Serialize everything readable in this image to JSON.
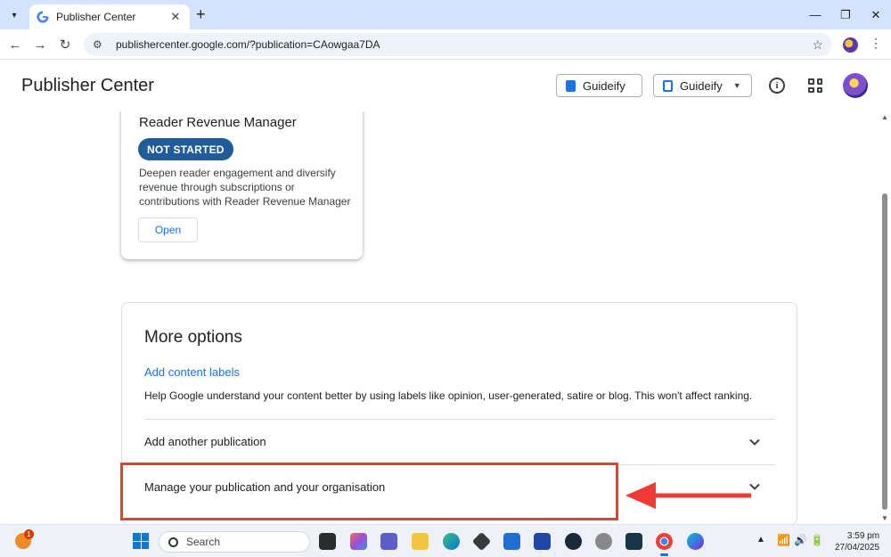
{
  "browser": {
    "tab_title": "Publisher Center",
    "url": "publishercenter.google.com/?publication=CAowgaa7DA",
    "new_tab_glyph": "+",
    "window_controls": [
      "—",
      "❐",
      "✕"
    ]
  },
  "header": {
    "app_title": "Publisher Center",
    "publication_button": "Guideify",
    "publication_dropdown": "Guideify"
  },
  "rrm_card": {
    "title": "Reader Revenue Manager",
    "status": "NOT STARTED",
    "description": "Deepen reader engagement and diversify revenue through subscriptions or contributions with Reader Revenue Manager",
    "open_label": "Open"
  },
  "more_options": {
    "title": "More options",
    "content_labels_link": "Add content labels",
    "content_labels_help": "Help Google understand your content better by using labels like opinion, user-generated, satire or blog. This won't affect ranking.",
    "rows": [
      {
        "label": "Add another publication"
      },
      {
        "label": "Manage your publication and your organisation"
      }
    ]
  },
  "taskbar": {
    "weather_badge": "1",
    "search_placeholder": "Search",
    "time": "3:59 pm",
    "date": "27/04/2025"
  },
  "colors": {
    "accent": "#1a73e8",
    "badge_bg": "#1f5c99",
    "annotation_red": "#ef3b36"
  }
}
